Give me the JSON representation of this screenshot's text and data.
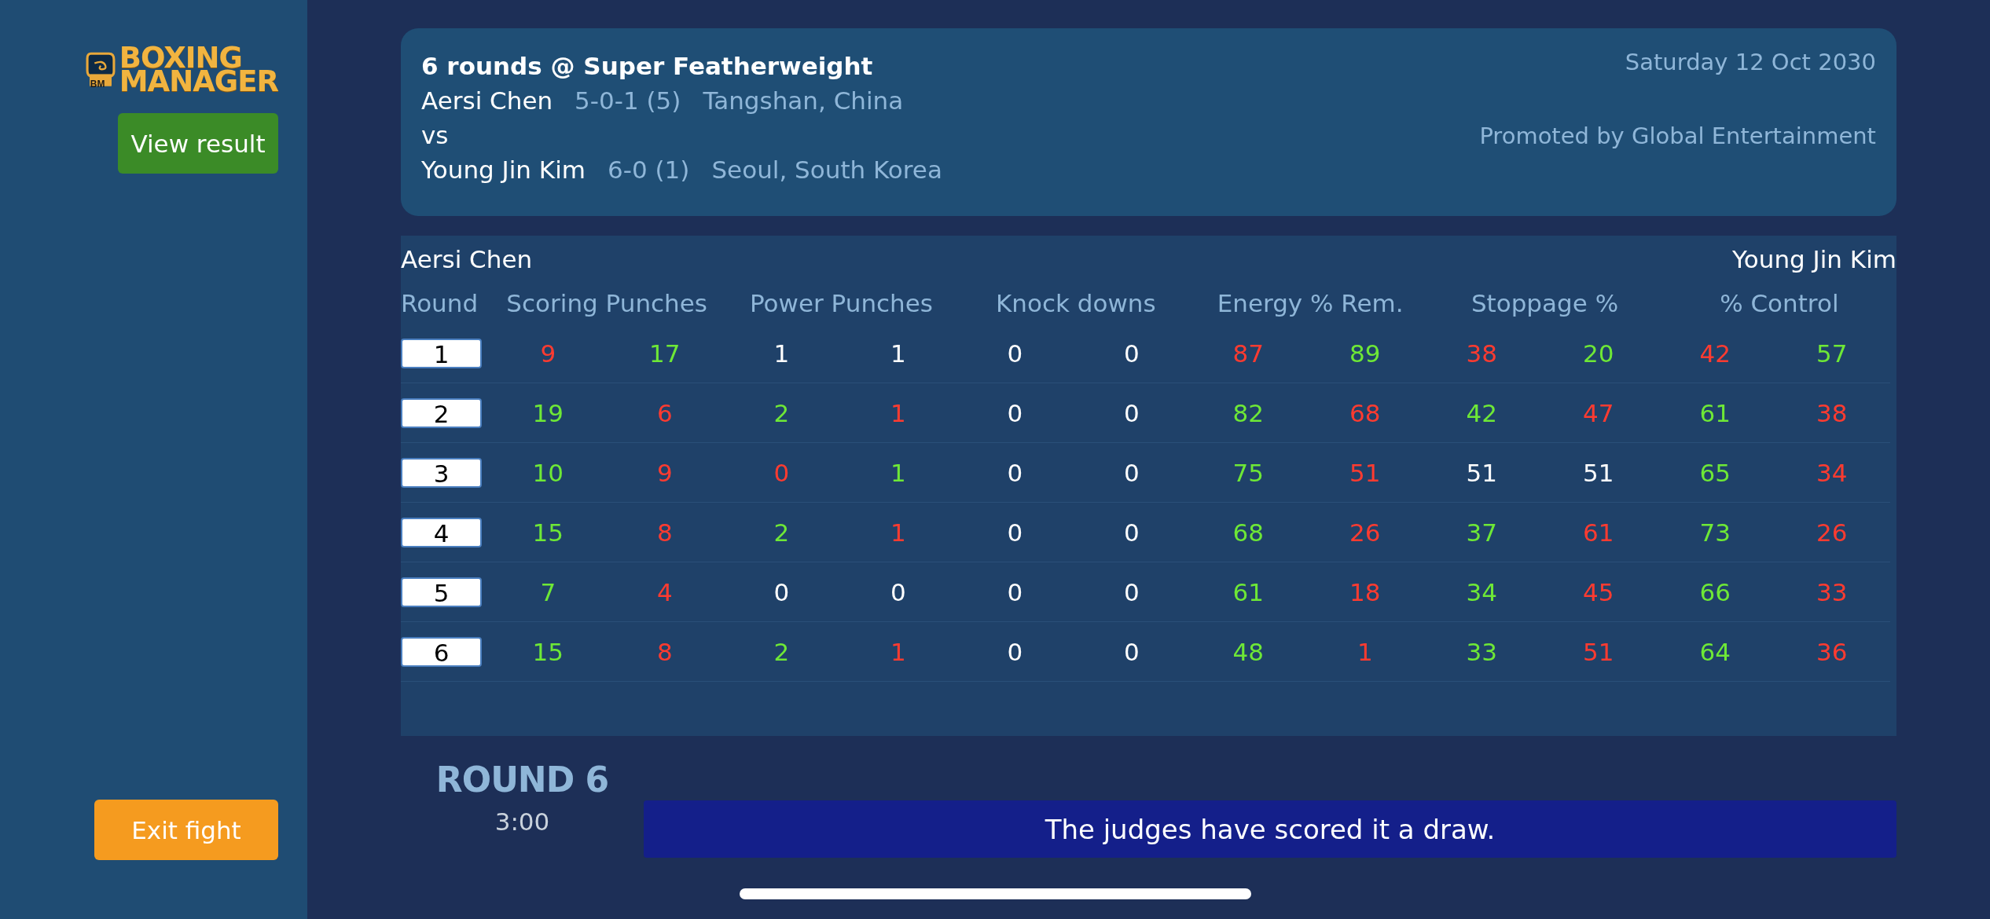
{
  "logo": {
    "badge": "BM",
    "line1": "BOXING",
    "line2": "MANAGER"
  },
  "sidebar": {
    "buttons": [
      {
        "label": "View result",
        "kind": "primary"
      },
      {
        "label": "Exit fight",
        "kind": "exit"
      }
    ]
  },
  "fight": {
    "title": "6 rounds @ Super Featherweight",
    "date": "Saturday 12 Oct 2030",
    "promoter": "Promoted by Global Entertainment",
    "vs": "vs",
    "fighters": [
      {
        "name": "Aersi Chen",
        "record": "5-0-1 (5)",
        "hometown": "Tangshan, China"
      },
      {
        "name": "Young Jin Kim",
        "record": "6-0 (1)",
        "hometown": "Seoul, South Korea"
      }
    ]
  },
  "table": {
    "left_fighter": "Aersi Chen",
    "right_fighter": "Young Jin Kim",
    "columns": [
      "Round",
      "Scoring Punches",
      "Power Punches",
      "Knock downs",
      "Energy % Rem.",
      "Stoppage %",
      "% Control"
    ],
    "rows": [
      {
        "cells": [
          {
            "kind": "round",
            "value": "1"
          },
          {
            "kind": "pair",
            "values": [
              {
                "value": "9",
                "color": "#ff3b30"
              },
              {
                "value": "17",
                "color": "#6ee836"
              }
            ]
          },
          {
            "kind": "pair",
            "values": [
              {
                "value": "1",
                "color": "#ffffff"
              },
              {
                "value": "1",
                "color": "#ffffff"
              }
            ]
          },
          {
            "kind": "pair",
            "values": [
              {
                "value": "0",
                "color": "#ffffff"
              },
              {
                "value": "0",
                "color": "#ffffff"
              }
            ]
          },
          {
            "kind": "pair",
            "values": [
              {
                "value": "87",
                "color": "#ff3b30"
              },
              {
                "value": "89",
                "color": "#6ee836"
              }
            ]
          },
          {
            "kind": "pair",
            "values": [
              {
                "value": "38",
                "color": "#ff3b30"
              },
              {
                "value": "20",
                "color": "#6ee836"
              }
            ]
          },
          {
            "kind": "pair",
            "values": [
              {
                "value": "42",
                "color": "#ff3b30"
              },
              {
                "value": "57",
                "color": "#6ee836"
              }
            ]
          }
        ]
      },
      {
        "cells": [
          {
            "kind": "round",
            "value": "2"
          },
          {
            "kind": "pair",
            "values": [
              {
                "value": "19",
                "color": "#6ee836"
              },
              {
                "value": "6",
                "color": "#ff3b30"
              }
            ]
          },
          {
            "kind": "pair",
            "values": [
              {
                "value": "2",
                "color": "#6ee836"
              },
              {
                "value": "1",
                "color": "#ff3b30"
              }
            ]
          },
          {
            "kind": "pair",
            "values": [
              {
                "value": "0",
                "color": "#ffffff"
              },
              {
                "value": "0",
                "color": "#ffffff"
              }
            ]
          },
          {
            "kind": "pair",
            "values": [
              {
                "value": "82",
                "color": "#6ee836"
              },
              {
                "value": "68",
                "color": "#ff3b30"
              }
            ]
          },
          {
            "kind": "pair",
            "values": [
              {
                "value": "42",
                "color": "#6ee836"
              },
              {
                "value": "47",
                "color": "#ff3b30"
              }
            ]
          },
          {
            "kind": "pair",
            "values": [
              {
                "value": "61",
                "color": "#6ee836"
              },
              {
                "value": "38",
                "color": "#ff3b30"
              }
            ]
          }
        ]
      },
      {
        "cells": [
          {
            "kind": "round",
            "value": "3"
          },
          {
            "kind": "pair",
            "values": [
              {
                "value": "10",
                "color": "#6ee836"
              },
              {
                "value": "9",
                "color": "#ff3b30"
              }
            ]
          },
          {
            "kind": "pair",
            "values": [
              {
                "value": "0",
                "color": "#ff3b30"
              },
              {
                "value": "1",
                "color": "#6ee836"
              }
            ]
          },
          {
            "kind": "pair",
            "values": [
              {
                "value": "0",
                "color": "#ffffff"
              },
              {
                "value": "0",
                "color": "#ffffff"
              }
            ]
          },
          {
            "kind": "pair",
            "values": [
              {
                "value": "75",
                "color": "#6ee836"
              },
              {
                "value": "51",
                "color": "#ff3b30"
              }
            ]
          },
          {
            "kind": "pair",
            "values": [
              {
                "value": "51",
                "color": "#ffffff"
              },
              {
                "value": "51",
                "color": "#ffffff"
              }
            ]
          },
          {
            "kind": "pair",
            "values": [
              {
                "value": "65",
                "color": "#6ee836"
              },
              {
                "value": "34",
                "color": "#ff3b30"
              }
            ]
          }
        ]
      },
      {
        "cells": [
          {
            "kind": "round",
            "value": "4"
          },
          {
            "kind": "pair",
            "values": [
              {
                "value": "15",
                "color": "#6ee836"
              },
              {
                "value": "8",
                "color": "#ff3b30"
              }
            ]
          },
          {
            "kind": "pair",
            "values": [
              {
                "value": "2",
                "color": "#6ee836"
              },
              {
                "value": "1",
                "color": "#ff3b30"
              }
            ]
          },
          {
            "kind": "pair",
            "values": [
              {
                "value": "0",
                "color": "#ffffff"
              },
              {
                "value": "0",
                "color": "#ffffff"
              }
            ]
          },
          {
            "kind": "pair",
            "values": [
              {
                "value": "68",
                "color": "#6ee836"
              },
              {
                "value": "26",
                "color": "#ff3b30"
              }
            ]
          },
          {
            "kind": "pair",
            "values": [
              {
                "value": "37",
                "color": "#6ee836"
              },
              {
                "value": "61",
                "color": "#ff3b30"
              }
            ]
          },
          {
            "kind": "pair",
            "values": [
              {
                "value": "73",
                "color": "#6ee836"
              },
              {
                "value": "26",
                "color": "#ff3b30"
              }
            ]
          }
        ]
      },
      {
        "cells": [
          {
            "kind": "round",
            "value": "5"
          },
          {
            "kind": "pair",
            "values": [
              {
                "value": "7",
                "color": "#6ee836"
              },
              {
                "value": "4",
                "color": "#ff3b30"
              }
            ]
          },
          {
            "kind": "pair",
            "values": [
              {
                "value": "0",
                "color": "#ffffff"
              },
              {
                "value": "0",
                "color": "#ffffff"
              }
            ]
          },
          {
            "kind": "pair",
            "values": [
              {
                "value": "0",
                "color": "#ffffff"
              },
              {
                "value": "0",
                "color": "#ffffff"
              }
            ]
          },
          {
            "kind": "pair",
            "values": [
              {
                "value": "61",
                "color": "#6ee836"
              },
              {
                "value": "18",
                "color": "#ff3b30"
              }
            ]
          },
          {
            "kind": "pair",
            "values": [
              {
                "value": "34",
                "color": "#6ee836"
              },
              {
                "value": "45",
                "color": "#ff3b30"
              }
            ]
          },
          {
            "kind": "pair",
            "values": [
              {
                "value": "66",
                "color": "#6ee836"
              },
              {
                "value": "33",
                "color": "#ff3b30"
              }
            ]
          }
        ]
      },
      {
        "cells": [
          {
            "kind": "round",
            "value": "6"
          },
          {
            "kind": "pair",
            "values": [
              {
                "value": "15",
                "color": "#6ee836"
              },
              {
                "value": "8",
                "color": "#ff3b30"
              }
            ]
          },
          {
            "kind": "pair",
            "values": [
              {
                "value": "2",
                "color": "#6ee836"
              },
              {
                "value": "1",
                "color": "#ff3b30"
              }
            ]
          },
          {
            "kind": "pair",
            "values": [
              {
                "value": "0",
                "color": "#ffffff"
              },
              {
                "value": "0",
                "color": "#ffffff"
              }
            ]
          },
          {
            "kind": "pair",
            "values": [
              {
                "value": "48",
                "color": "#6ee836"
              },
              {
                "value": "1",
                "color": "#ff3b30"
              }
            ]
          },
          {
            "kind": "pair",
            "values": [
              {
                "value": "33",
                "color": "#6ee836"
              },
              {
                "value": "51",
                "color": "#ff3b30"
              }
            ]
          },
          {
            "kind": "pair",
            "values": [
              {
                "value": "64",
                "color": "#6ee836"
              },
              {
                "value": "36",
                "color": "#ff3b30"
              }
            ]
          }
        ]
      }
    ]
  },
  "status": {
    "round_label": "ROUND 6",
    "clock": "3:00",
    "message": "The judges have scored it a draw."
  }
}
